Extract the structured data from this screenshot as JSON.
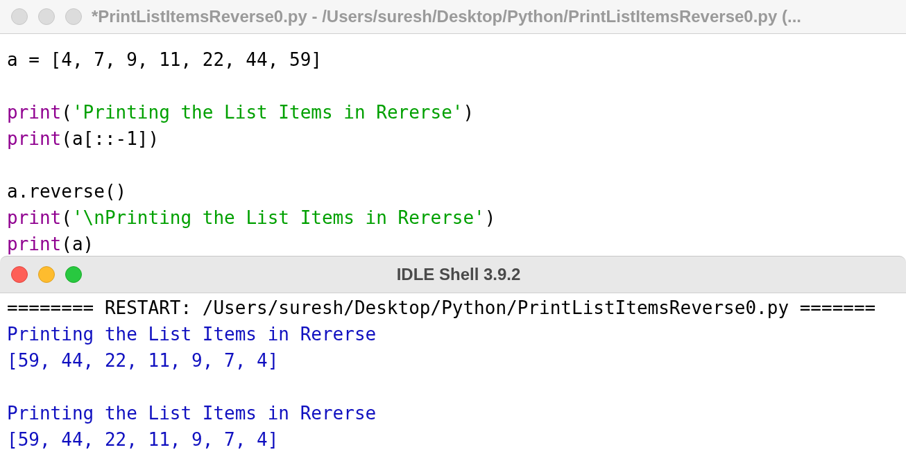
{
  "editor": {
    "title": "*PrintListItemsReverse0.py - /Users/suresh/Desktop/Python/PrintListItemsReverse0.py (...",
    "active": false,
    "lines": [
      {
        "kind": "code",
        "tokens": [
          {
            "kind": "plain",
            "text": "a = [4, 7, 9, 11, 22, 44, 59]"
          }
        ]
      },
      {
        "kind": "blank"
      },
      {
        "kind": "code",
        "tokens": [
          {
            "kind": "builtin",
            "text": "print"
          },
          {
            "kind": "plain",
            "text": "("
          },
          {
            "kind": "string",
            "text": "'Printing the List Items in Rererse'"
          },
          {
            "kind": "plain",
            "text": ")"
          }
        ]
      },
      {
        "kind": "code",
        "tokens": [
          {
            "kind": "builtin",
            "text": "print"
          },
          {
            "kind": "plain",
            "text": "(a[::-1])"
          }
        ]
      },
      {
        "kind": "blank"
      },
      {
        "kind": "code",
        "tokens": [
          {
            "kind": "plain",
            "text": "a.reverse()"
          }
        ]
      },
      {
        "kind": "code",
        "tokens": [
          {
            "kind": "builtin",
            "text": "print"
          },
          {
            "kind": "plain",
            "text": "("
          },
          {
            "kind": "string",
            "text": "'\\nPrinting the List Items in Rererse'"
          },
          {
            "kind": "plain",
            "text": ")"
          }
        ]
      },
      {
        "kind": "code",
        "tokens": [
          {
            "kind": "builtin",
            "text": "print"
          },
          {
            "kind": "plain",
            "text": "(a)"
          }
        ]
      }
    ]
  },
  "shell": {
    "title": "IDLE Shell 3.9.2",
    "active": true,
    "lines": [
      {
        "kind": "code",
        "tokens": [
          {
            "kind": "plain",
            "text": "======== RESTART: /Users/suresh/Desktop/Python/PrintListItemsReverse0.py ======="
          }
        ]
      },
      {
        "kind": "code",
        "tokens": [
          {
            "kind": "stdout",
            "text": "Printing the List Items in Rererse"
          }
        ]
      },
      {
        "kind": "code",
        "tokens": [
          {
            "kind": "stdout",
            "text": "[59, 44, 22, 11, 9, 7, 4]"
          }
        ]
      },
      {
        "kind": "blank"
      },
      {
        "kind": "code",
        "tokens": [
          {
            "kind": "stdout",
            "text": "Printing the List Items in Rererse"
          }
        ]
      },
      {
        "kind": "code",
        "tokens": [
          {
            "kind": "stdout",
            "text": "[59, 44, 22, 11, 9, 7, 4]"
          }
        ]
      }
    ]
  }
}
